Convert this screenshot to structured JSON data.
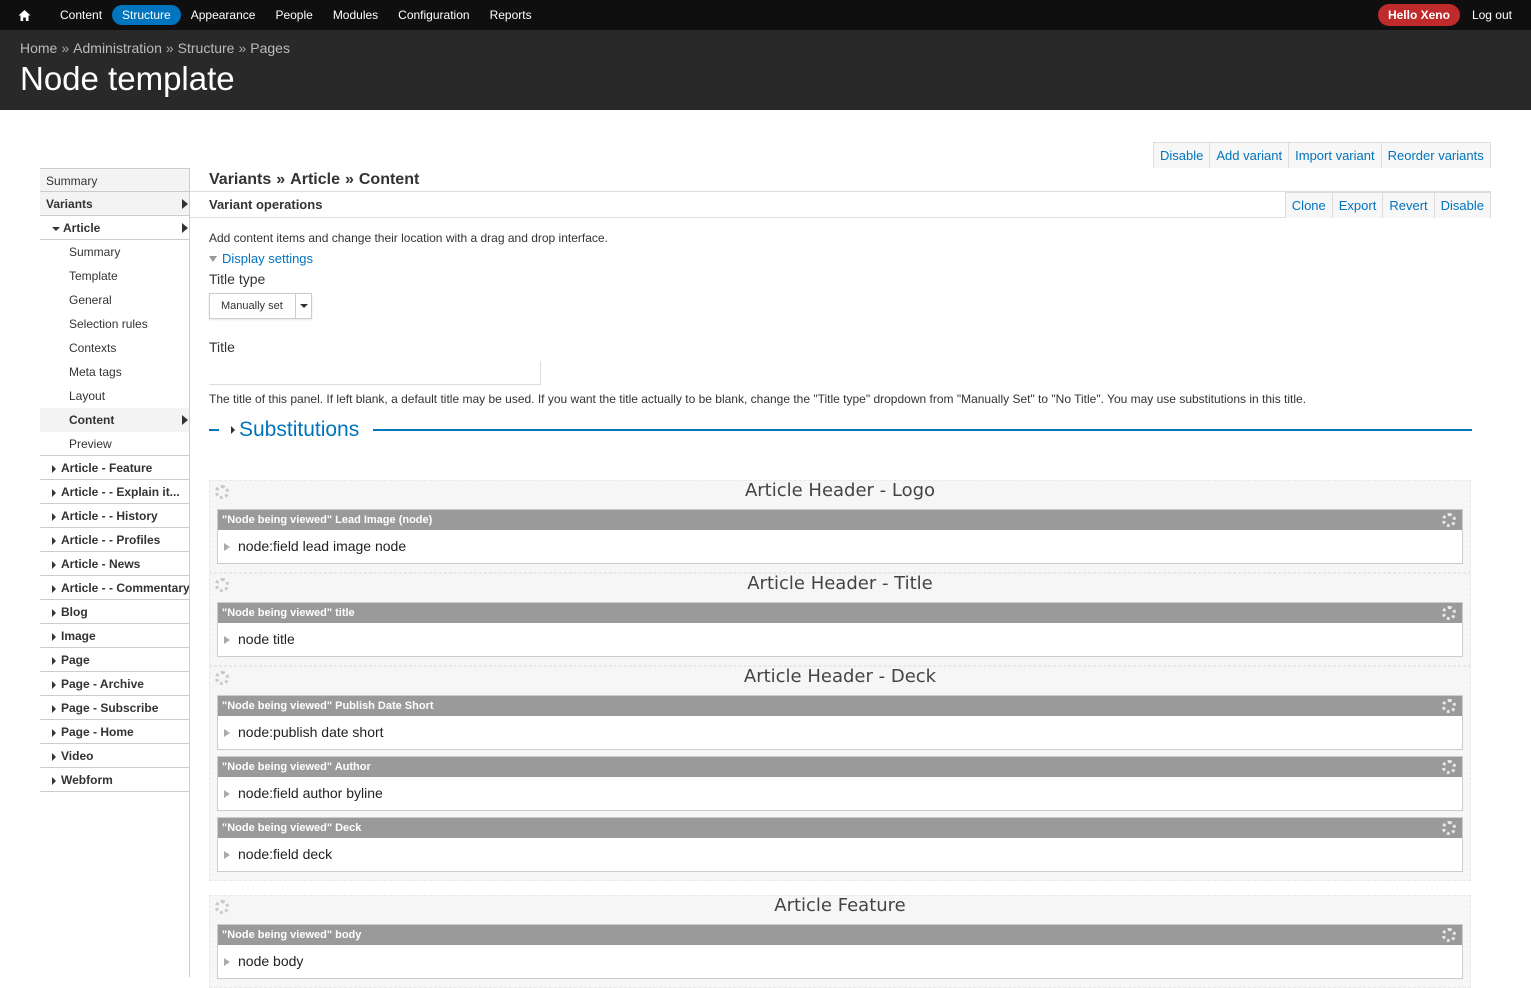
{
  "toolbar": {
    "items": [
      "Content",
      "Structure",
      "Appearance",
      "People",
      "Modules",
      "Configuration",
      "Reports"
    ],
    "hello": "Hello Xeno",
    "logout": "Log out"
  },
  "breadcrumb": [
    "Home",
    "Administration",
    "Structure",
    "Pages"
  ],
  "breadcrumb_sep": "»",
  "page_title": "Node template",
  "top_actions": [
    "Disable",
    "Add variant",
    "Import variant",
    "Reorder variants"
  ],
  "sidebar": {
    "summary": "Summary",
    "variants": "Variants",
    "article": "Article",
    "article_items": [
      "Summary",
      "Template",
      "General",
      "Selection rules",
      "Contexts",
      "Meta tags",
      "Layout",
      "Content",
      "Preview"
    ],
    "others": [
      "Article - Feature",
      "Article - - Explain it...",
      "Article - - History",
      "Article - - Profiles",
      "Article - News",
      "Article - - Commentary",
      "Blog",
      "Image",
      "Page",
      "Page - Archive",
      "Page - Subscribe",
      "Page - Home",
      "Video",
      "Webform"
    ]
  },
  "variant_breadcrumb": [
    "Variants",
    "Article",
    "Content"
  ],
  "variant_ops": {
    "title": "Variant operations",
    "actions": [
      "Clone",
      "Export",
      "Revert",
      "Disable"
    ]
  },
  "content": {
    "help": "Add content items and change their location with a drag and drop interface.",
    "display_settings": "Display settings",
    "title_type_label": "Title type",
    "title_type_value": "Manually set",
    "title_label": "Title",
    "title_value": "",
    "description": "The title of this panel. If left blank, a default title may be used. If you want the title actually to be blank, change the \"Title type\" dropdown from \"Manually Set\" to \"No Title\". You may use substitutions in this title.",
    "substitutions": "Substitutions"
  },
  "regions": [
    {
      "title": "Article Header - Logo",
      "panes": [
        {
          "head": "\"Node being viewed\" Lead Image (node)",
          "body": "node:field lead image node"
        }
      ]
    },
    {
      "title": "Article Header - Title",
      "panes": [
        {
          "head": "\"Node being viewed\" title",
          "body": "node title"
        }
      ]
    },
    {
      "title": "Article Header - Deck",
      "panes": [
        {
          "head": "\"Node being viewed\" Publish Date Short",
          "body": "node:publish date short"
        },
        {
          "head": "\"Node being viewed\" Author",
          "body": "node:field author byline"
        },
        {
          "head": "\"Node being viewed\" Deck",
          "body": "node:field deck"
        }
      ]
    },
    {
      "title": "Article Feature",
      "panes": [
        {
          "head": "\"Node being viewed\" body",
          "body": "node body"
        }
      ]
    }
  ]
}
